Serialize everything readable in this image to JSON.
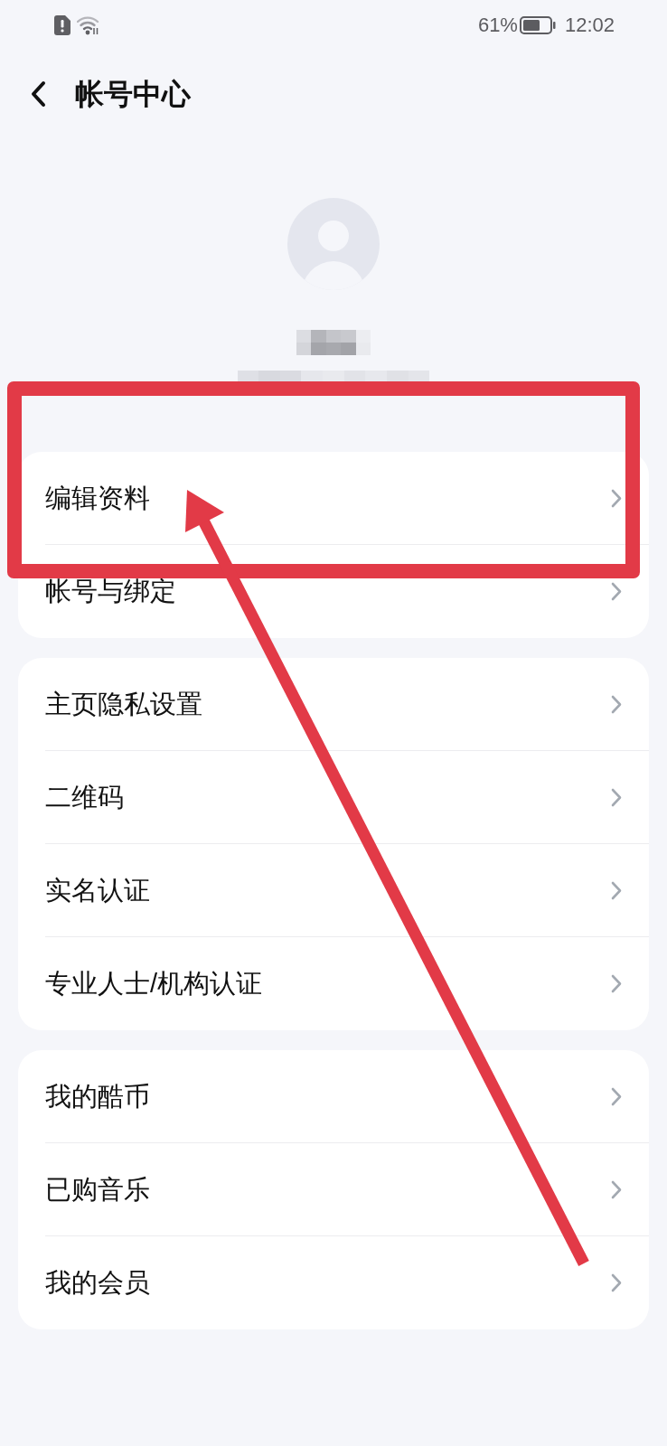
{
  "status_bar": {
    "battery": "61%",
    "time": "12:02"
  },
  "header": {
    "title": "帐号中心"
  },
  "groups": [
    {
      "items": [
        {
          "label": "编辑资料"
        },
        {
          "label": "帐号与绑定"
        }
      ]
    },
    {
      "items": [
        {
          "label": "主页隐私设置"
        },
        {
          "label": "二维码"
        },
        {
          "label": "实名认证"
        },
        {
          "label": "专业人士/机构认证"
        }
      ]
    },
    {
      "items": [
        {
          "label": "我的酷币"
        },
        {
          "label": "已购音乐"
        },
        {
          "label": "我的会员"
        }
      ]
    }
  ]
}
